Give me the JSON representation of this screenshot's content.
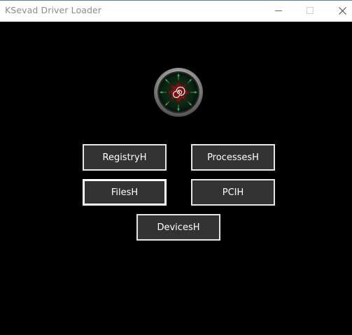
{
  "window": {
    "title": "KSevad Driver Loader"
  },
  "buttons": {
    "registry": "RegistryH",
    "processes": "ProcessesH",
    "files": "FilesH",
    "pci": "PCIH",
    "devices": "DevicesH"
  },
  "colors": {
    "background": "#000000",
    "button_fill": "#333333",
    "button_border": "#e6e6e6",
    "logo_green": "#1f8a3a",
    "logo_red": "#8a1a1a"
  },
  "icons": {
    "logo": "spiral-emblem-icon",
    "minimize": "minimize-icon",
    "maximize": "maximize-icon",
    "close": "close-icon"
  }
}
